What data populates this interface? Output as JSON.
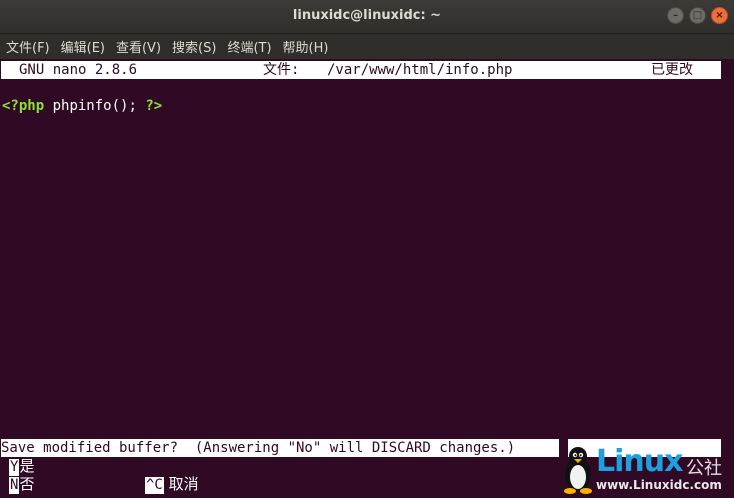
{
  "window": {
    "title": "linuxidc@linuxidc: ~"
  },
  "menubar": {
    "items": [
      "文件(F)",
      "编辑(E)",
      "查看(V)",
      "搜索(S)",
      "终端(T)",
      "帮助(H)"
    ]
  },
  "nano": {
    "version": "GNU nano 2.8.6",
    "file_label": "文件:",
    "file_path": "/var/www/html/info.php",
    "modified": "已更改",
    "code_open": "<?php",
    "code_body": " phpinfo(); ",
    "code_close": "?>",
    "status_message": "Save modified buffer?  (Answering \"No\" will DISCARD changes.)",
    "shortcuts": [
      {
        "key": "Y",
        "desc": "是"
      },
      {
        "key": "N",
        "desc": "否"
      },
      {
        "key": "^C",
        "desc": "取消"
      }
    ]
  },
  "watermark": {
    "brand": "Linux",
    "cn": "公社",
    "url": "www.Linuxidc.com"
  },
  "colors": {
    "terminal_bg": "#300a24",
    "php_tag": "#8ae234",
    "logo_blue": "#1e9fe0"
  }
}
